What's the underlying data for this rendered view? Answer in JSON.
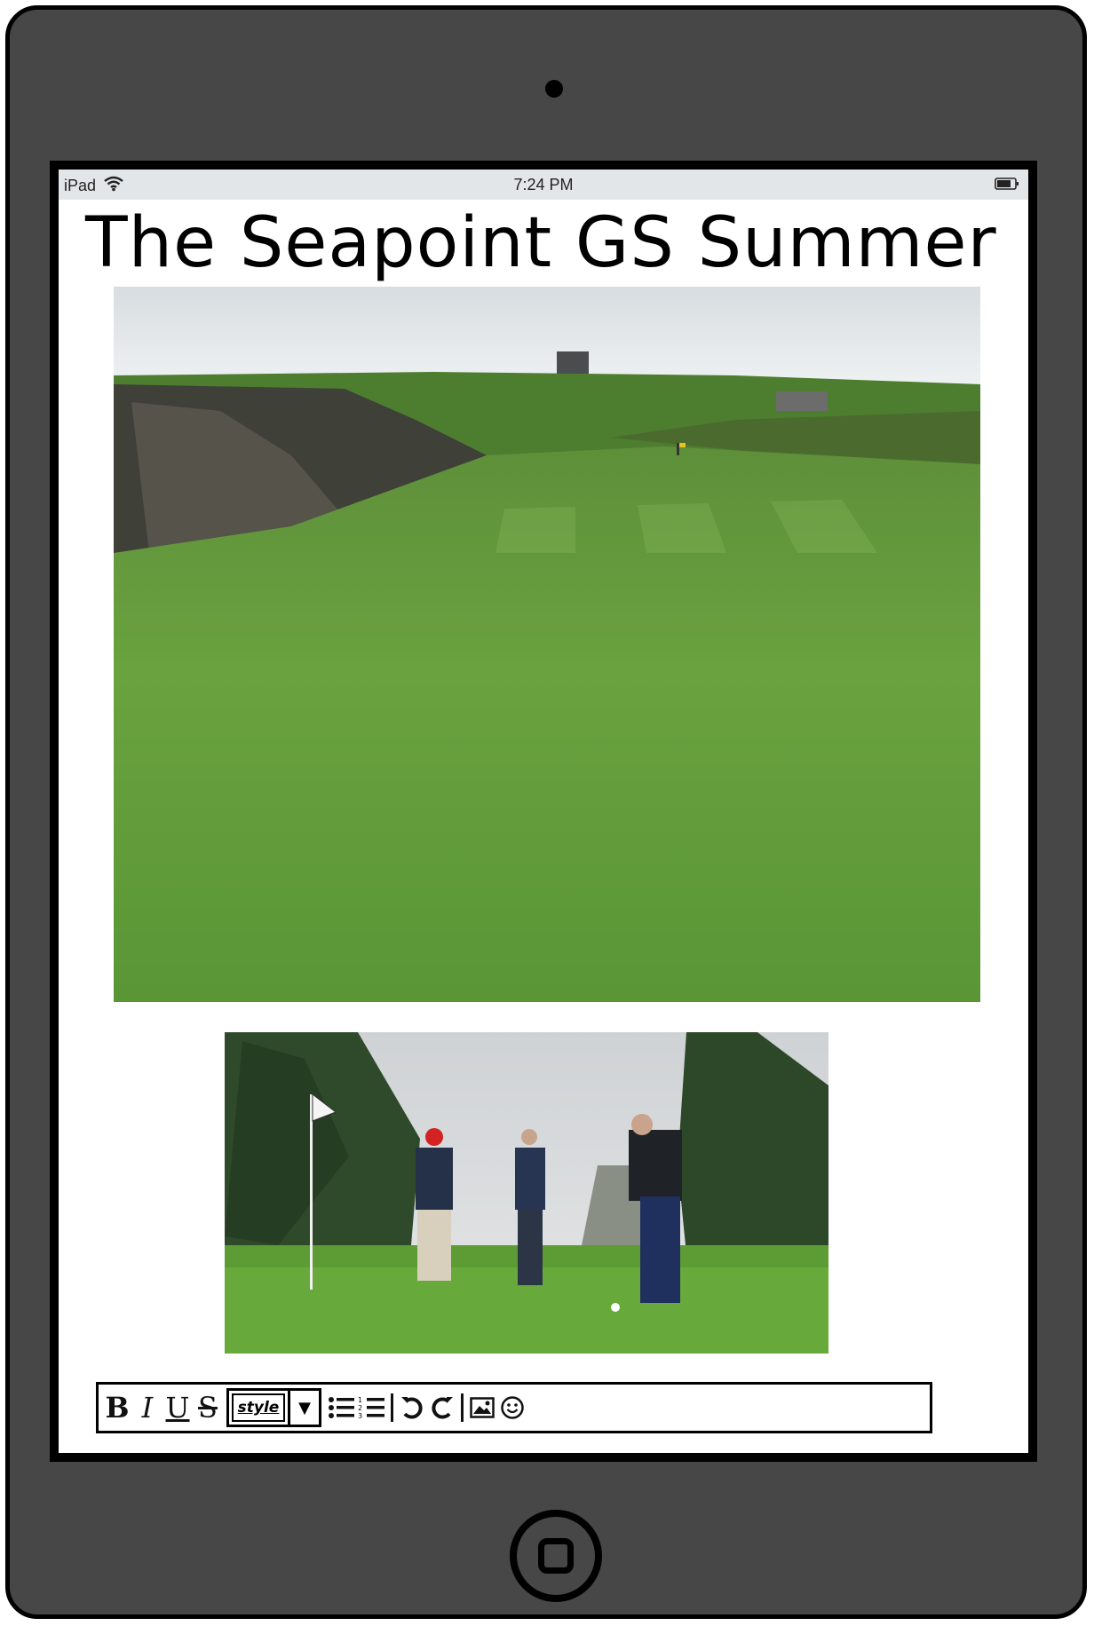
{
  "status_bar": {
    "device": "iPad",
    "time": "7:24 PM",
    "wifi_icon": "wifi-icon",
    "battery_icon": "battery-icon"
  },
  "page": {
    "title": "The Seapoint GS Summer"
  },
  "images": [
    {
      "name": "golf-course-photo",
      "description_icon": "image"
    },
    {
      "name": "golfers-photo",
      "description_icon": "image"
    }
  ],
  "toolbar": {
    "bold": "B",
    "italic": "I",
    "underline": "U",
    "strikethrough": "S",
    "style_label": "style",
    "style_arrow": "▼",
    "icons": [
      "bold-icon",
      "italic-icon",
      "underline-icon",
      "strikethrough-icon",
      "style-dropdown",
      "bullet-list-icon",
      "numbered-list-icon",
      "undo-icon",
      "redo-icon",
      "insert-image-icon",
      "emoji-icon"
    ]
  },
  "colors": {
    "device_body": "#474747",
    "status_bar": "#e3e6e8",
    "grass": "#5f9a3a",
    "sky": "#dfe3e6"
  }
}
